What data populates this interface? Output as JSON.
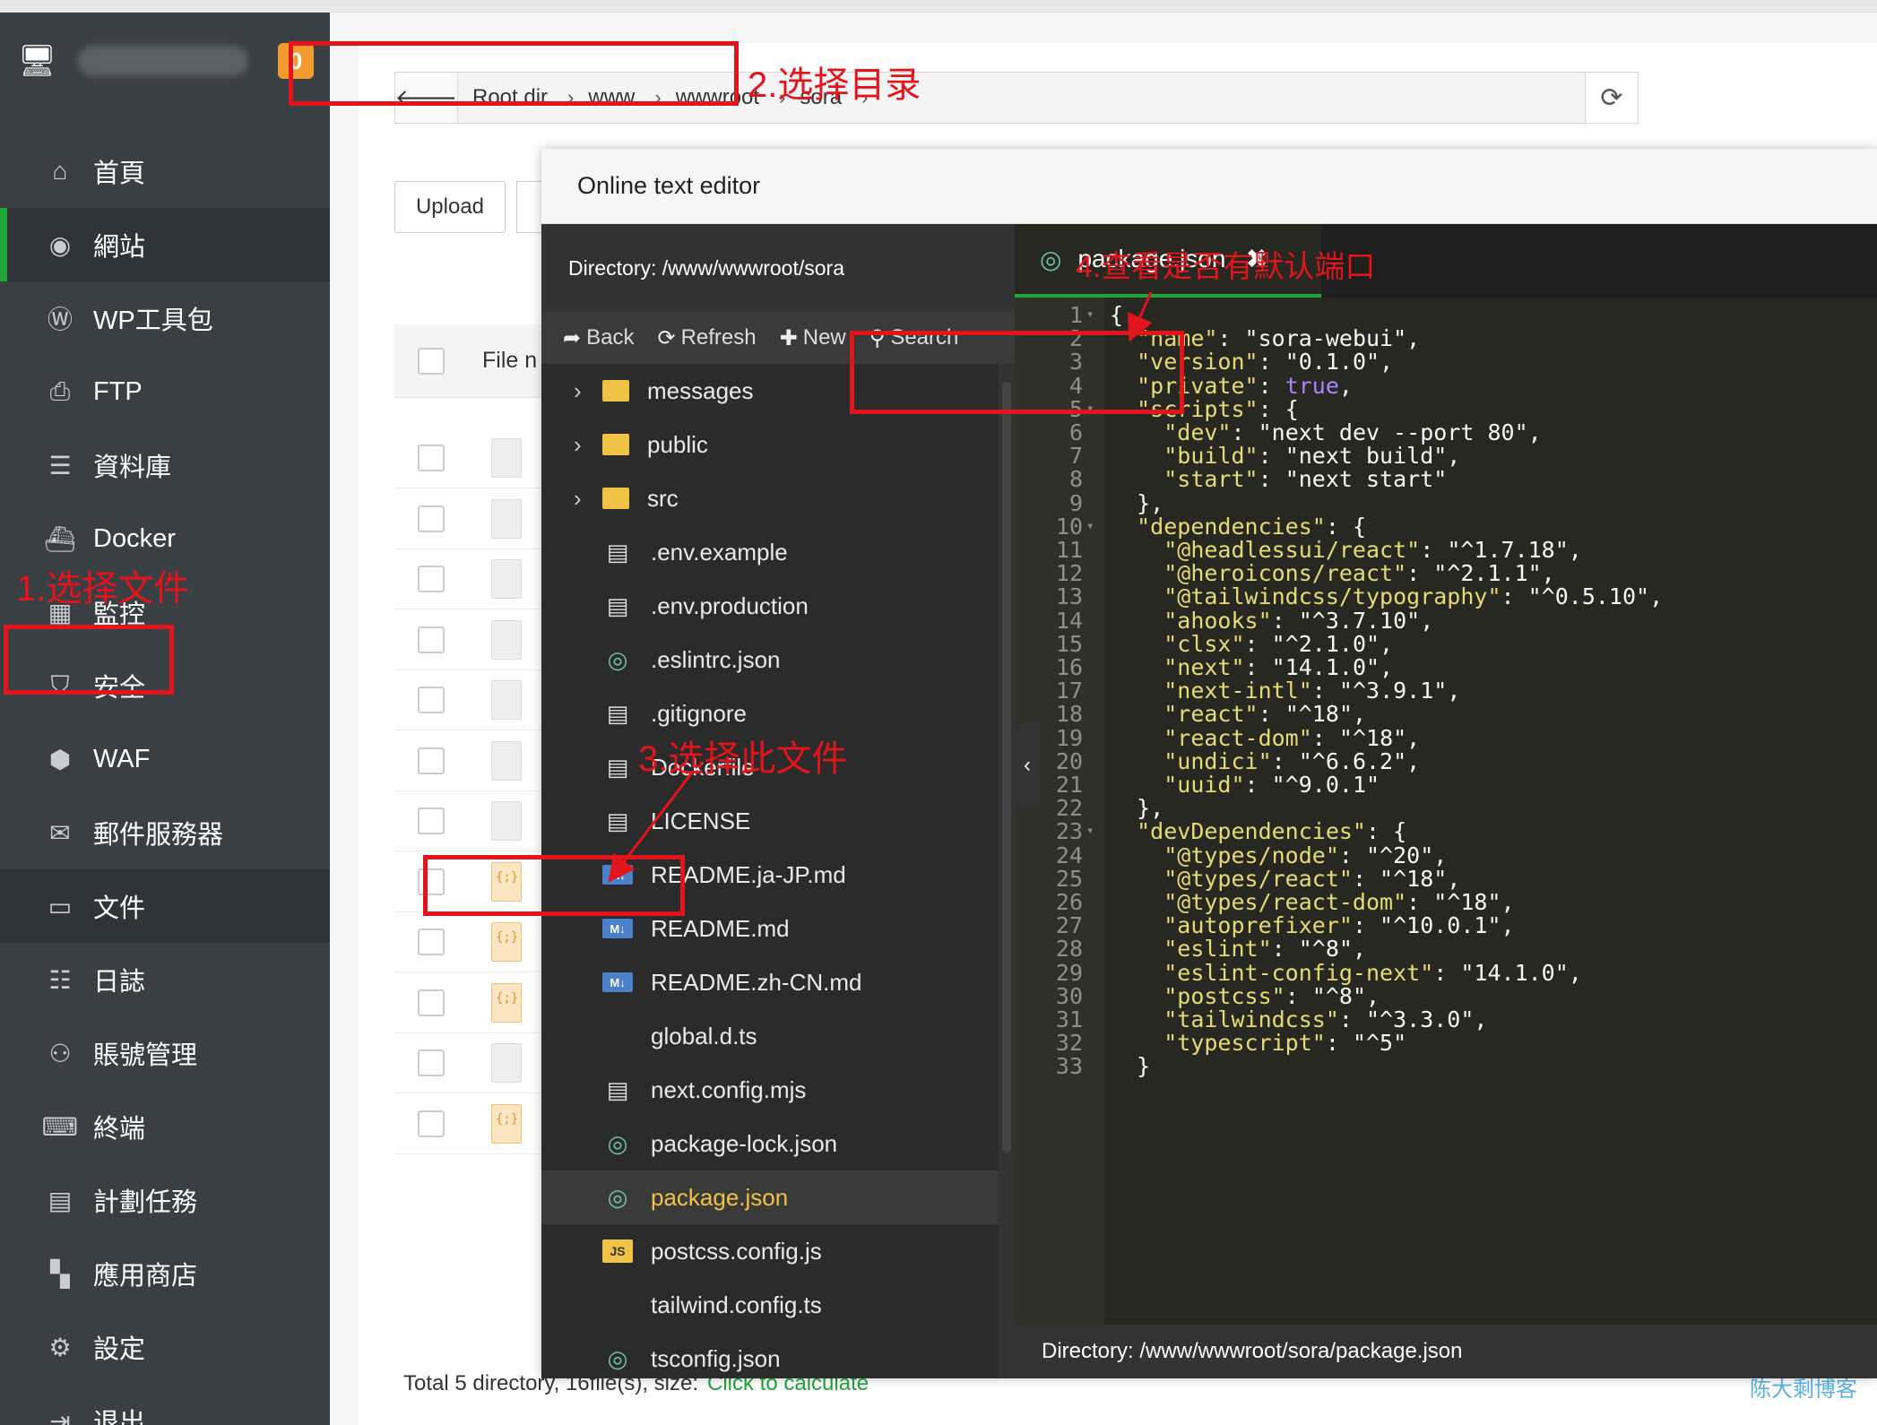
{
  "sidebar": {
    "badge": "0",
    "items": [
      {
        "label": "首頁",
        "icon": "home-icon",
        "glyph": "⌂"
      },
      {
        "label": "網站",
        "icon": "globe-icon",
        "glyph": "◉"
      },
      {
        "label": "WP工具包",
        "icon": "wordpress-icon",
        "glyph": "Ⓦ"
      },
      {
        "label": "FTP",
        "icon": "ftp-icon",
        "glyph": "⎙"
      },
      {
        "label": "資料庫",
        "icon": "database-icon",
        "glyph": "☰"
      },
      {
        "label": "Docker",
        "icon": "docker-icon",
        "glyph": "⛴"
      },
      {
        "label": "監控",
        "icon": "monitor-icon",
        "glyph": "▦"
      },
      {
        "label": "安全",
        "icon": "shield-icon",
        "glyph": "⛉"
      },
      {
        "label": "WAF",
        "icon": "waf-icon",
        "glyph": "⬢"
      },
      {
        "label": "郵件服務器",
        "icon": "mail-icon",
        "glyph": "✉"
      },
      {
        "label": "文件",
        "icon": "folder-icon",
        "glyph": "▭"
      },
      {
        "label": "日誌",
        "icon": "log-icon",
        "glyph": "☷"
      },
      {
        "label": "賬號管理",
        "icon": "users-icon",
        "glyph": "⚇"
      },
      {
        "label": "終端",
        "icon": "terminal-icon",
        "glyph": "⌨"
      },
      {
        "label": "計劃任務",
        "icon": "calendar-icon",
        "glyph": "▤"
      },
      {
        "label": "應用商店",
        "icon": "apps-icon",
        "glyph": "▚"
      },
      {
        "label": "設定",
        "icon": "gear-icon",
        "glyph": "⚙"
      },
      {
        "label": "退出",
        "icon": "logout-icon",
        "glyph": "⇥"
      }
    ]
  },
  "breadcrumb": {
    "items": [
      "Root dir",
      "www",
      "wwwroot",
      "sora"
    ]
  },
  "toolbar": {
    "upload_label": "Upload"
  },
  "file_table": {
    "header_label": "File n"
  },
  "footer": {
    "total_text": "Total 5 directory, 16file(s), size:",
    "calc_link": "Click to calculate",
    "watermark": "陈大剩博客"
  },
  "editor": {
    "title": "Online text editor",
    "directory": "Directory: /www/wwwroot/sora",
    "toolbar": {
      "back": "Back",
      "refresh": "Refresh",
      "new": "New",
      "search": "Search"
    },
    "tab_name": "package.json",
    "status": "Directory: /www/wwwroot/sora/package.json",
    "files": [
      {
        "name": "messages",
        "type": "folder"
      },
      {
        "name": "public",
        "type": "folder"
      },
      {
        "name": "src",
        "type": "folder"
      },
      {
        "name": ".env.example",
        "type": "doc"
      },
      {
        "name": ".env.production",
        "type": "doc"
      },
      {
        "name": ".eslintrc.json",
        "type": "json"
      },
      {
        "name": ".gitignore",
        "type": "doc"
      },
      {
        "name": "Dockerfile",
        "type": "doc"
      },
      {
        "name": "LICENSE",
        "type": "doc"
      },
      {
        "name": "README.ja-JP.md",
        "type": "md"
      },
      {
        "name": "README.md",
        "type": "md"
      },
      {
        "name": "README.zh-CN.md",
        "type": "md"
      },
      {
        "name": "global.d.ts",
        "type": "none"
      },
      {
        "name": "next.config.mjs",
        "type": "doc"
      },
      {
        "name": "package-lock.json",
        "type": "json"
      },
      {
        "name": "package.json",
        "type": "json",
        "selected": true
      },
      {
        "name": "postcss.config.js",
        "type": "js"
      },
      {
        "name": "tailwind.config.ts",
        "type": "none"
      },
      {
        "name": "tsconfig.json",
        "type": "json"
      }
    ],
    "code_lines": [
      "{",
      "  \"name\": \"sora-webui\",",
      "  \"version\": \"0.1.0\",",
      "  \"private\": true,",
      "  \"scripts\": {",
      "    \"dev\": \"next dev --port 80\",",
      "    \"build\": \"next build\",",
      "    \"start\": \"next start\"",
      "  },",
      "  \"dependencies\": {",
      "    \"@headlessui/react\": \"^1.7.18\",",
      "    \"@heroicons/react\": \"^2.1.1\",",
      "    \"@tailwindcss/typography\": \"^0.5.10\",",
      "    \"ahooks\": \"^3.7.10\",",
      "    \"clsx\": \"^2.1.0\",",
      "    \"next\": \"14.1.0\",",
      "    \"next-intl\": \"^3.9.1\",",
      "    \"react\": \"^18\",",
      "    \"react-dom\": \"^18\",",
      "    \"undici\": \"^6.6.2\",",
      "    \"uuid\": \"^9.0.1\"",
      "  },",
      "  \"devDependencies\": {",
      "    \"@types/node\": \"^20\",",
      "    \"@types/react\": \"^18\",",
      "    \"@types/react-dom\": \"^18\",",
      "    \"autoprefixer\": \"^10.0.1\",",
      "    \"eslint\": \"^8\",",
      "    \"eslint-config-next\": \"14.1.0\",",
      "    \"postcss\": \"^8\",",
      "    \"tailwindcss\": \"^3.3.0\",",
      "    \"typescript\": \"^5\"",
      "  }"
    ],
    "fold_lines": [
      1,
      5,
      10,
      23
    ]
  },
  "annotations": {
    "step1": "1.选择文件",
    "step2": "2.选择目录",
    "step3": "3.选择此文件",
    "step4": "4.查看是否有默认端口",
    "color": "#e3141b"
  }
}
